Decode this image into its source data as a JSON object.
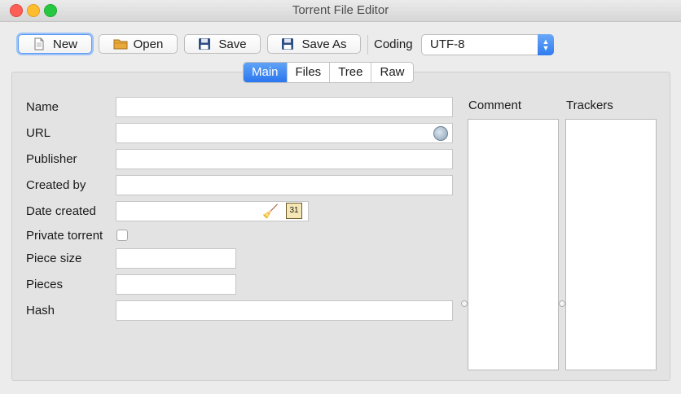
{
  "window": {
    "title": "Torrent File Editor"
  },
  "toolbar": {
    "new_label": "New",
    "open_label": "Open",
    "save_label": "Save",
    "save_as_label": "Save As",
    "coding_label": "Coding",
    "coding_value": "UTF-8"
  },
  "tabs": [
    {
      "label": "Main",
      "active": true
    },
    {
      "label": "Files",
      "active": false
    },
    {
      "label": "Tree",
      "active": false
    },
    {
      "label": "Raw",
      "active": false
    }
  ],
  "form": {
    "name_label": "Name",
    "url_label": "URL",
    "publisher_label": "Publisher",
    "created_by_label": "Created by",
    "date_created_label": "Date created",
    "private_torrent_label": "Private torrent",
    "piece_size_label": "Piece size",
    "pieces_label": "Pieces",
    "hash_label": "Hash",
    "name_value": "",
    "url_value": "",
    "publisher_value": "",
    "created_by_value": "",
    "date_created_value": "",
    "private_torrent_checked": false,
    "piece_size_value": "",
    "pieces_value": "",
    "hash_value": ""
  },
  "side": {
    "comment_label": "Comment",
    "trackers_label": "Trackers"
  },
  "icons": {
    "new": "document-icon",
    "open": "folder-icon",
    "save": "floppy-icon",
    "save_as": "floppy-icon",
    "url_action": "globe-icon",
    "date_clear": "broom-icon",
    "date_pick": "calendar-icon"
  },
  "colors": {
    "accent": "#2a76ef",
    "close": "#fd5f57",
    "minimize": "#febc2e",
    "maximize": "#27c840"
  }
}
